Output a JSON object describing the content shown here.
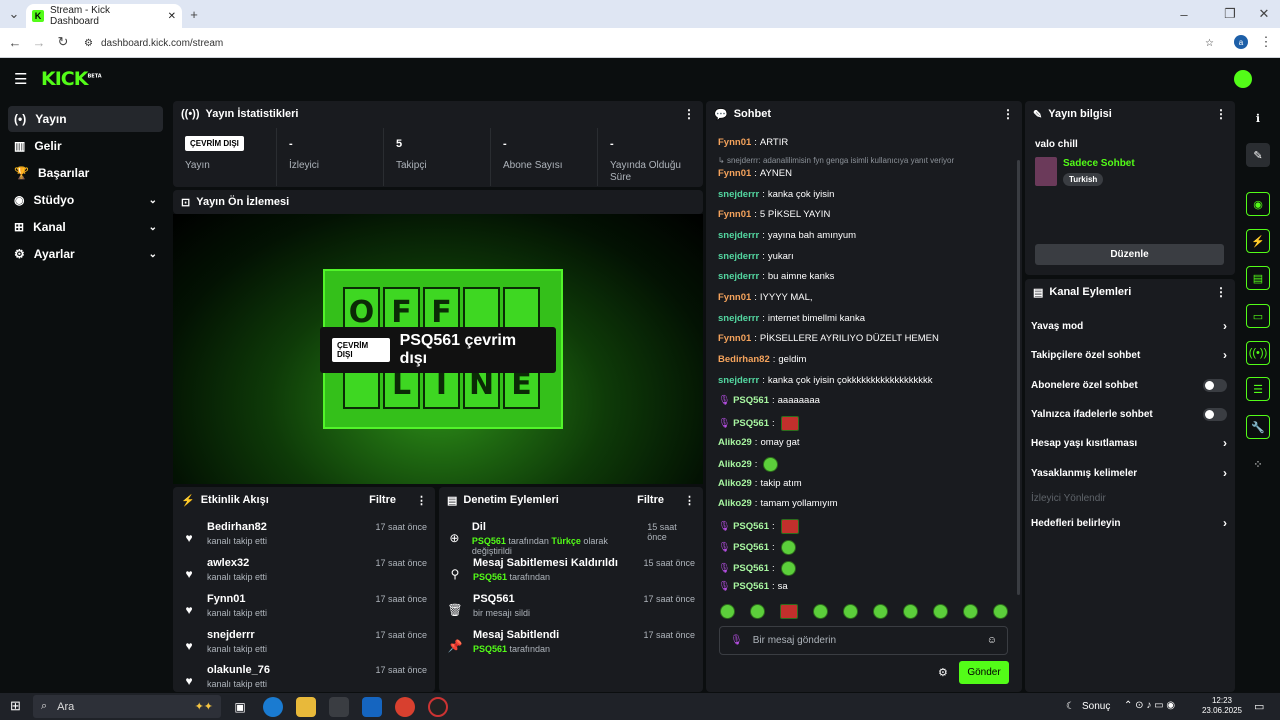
{
  "browser": {
    "tab_title": "Stream - Kick Dashboard",
    "url": "dashboard.kick.com/stream",
    "profile_initial": "a"
  },
  "app": {
    "logo": "KICK",
    "logo_sup": "BETA",
    "accent": "#53fc18"
  },
  "sidebar": {
    "items": [
      {
        "label": "Yayın",
        "icon": "broadcast-icon"
      },
      {
        "label": "Gelir",
        "icon": "chart-icon"
      },
      {
        "label": "Başarılar",
        "icon": "trophy-icon"
      },
      {
        "label": "Stüdyo",
        "icon": "studio-icon"
      },
      {
        "label": "Kanal",
        "icon": "channel-icon"
      },
      {
        "label": "Ayarlar",
        "icon": "gear-icon"
      }
    ]
  },
  "stats": {
    "title": "Yayın İstatistikleri",
    "status_badge": "ÇEVRİM DIŞI",
    "items": [
      {
        "value": "",
        "label": "Yayın"
      },
      {
        "value": "-",
        "label": "İzleyici"
      },
      {
        "value": "5",
        "label": "Takipçi"
      },
      {
        "value": "-",
        "label": "Abone Sayısı"
      },
      {
        "value": "-",
        "label": "Yayında Olduğu Süre"
      }
    ]
  },
  "preview": {
    "title": "Yayın Ön İzlemesi",
    "sign_top": [
      "O",
      "F",
      "F",
      ""
    ],
    "sign_bottom": [
      "",
      "L",
      "I",
      "N",
      "E"
    ],
    "badge": "ÇEVRİM DIŞI",
    "offline_text": "PSQ561 çevrim dışı"
  },
  "activity": {
    "title": "Etkinlik Akışı",
    "filter": "Filtre",
    "rows": [
      {
        "name": "Bedirhan82",
        "sub": "kanalı takip etti",
        "time": "17 saat önce"
      },
      {
        "name": "awlex32",
        "sub": "kanalı takip etti",
        "time": "17 saat önce"
      },
      {
        "name": "Fynn01",
        "sub": "kanalı takip etti",
        "time": "17 saat önce"
      },
      {
        "name": "snejderrr",
        "sub": "kanalı takip etti",
        "time": "17 saat önce"
      },
      {
        "name": "olakunle_76",
        "sub": "kanalı takip etti",
        "time": "17 saat önce"
      }
    ]
  },
  "moderation": {
    "title": "Denetim Eylemleri",
    "filter": "Filtre",
    "rows": [
      {
        "name": "Dil",
        "actor": "PSQ561",
        "mid": " tarafından ",
        "hl": "Türkçe",
        "end": " olarak değiştirildi",
        "time": "15 saat önce",
        "icon": "globe-icon"
      },
      {
        "name": "Mesaj Sabitlemesi Kaldırıldı",
        "actor": "PSQ561",
        "mid": " tarafından",
        "hl": "",
        "end": "",
        "time": "15 saat önce",
        "icon": "unpin-icon"
      },
      {
        "name": "PSQ561",
        "actor": "",
        "mid": "bir mesajı sildi",
        "hl": "",
        "end": "",
        "time": "17 saat önce",
        "icon": "trash-icon"
      },
      {
        "name": "Mesaj Sabitlendi",
        "actor": "PSQ561",
        "mid": " tarafından",
        "hl": "",
        "end": "",
        "time": "17 saat önce",
        "icon": "pin-icon"
      }
    ]
  },
  "chat": {
    "title": "Sohbet",
    "reply_hint": "snejderrr: adanalilimisin fyn genga isimli kullanıcıya yanıt veriyor",
    "messages": [
      {
        "user": "Fynn01",
        "color": "#f5a35c",
        "text": "ARTIR"
      },
      {
        "user": "Fynn01",
        "color": "#f5a35c",
        "text": "AYNEN"
      },
      {
        "user": "snejderrr",
        "color": "#53d6a0",
        "text": "kanka çok iyisin"
      },
      {
        "user": "Fynn01",
        "color": "#f5a35c",
        "text": "5 PİKSEL YAYIN"
      },
      {
        "user": "snejderrr",
        "color": "#53d6a0",
        "text": "yayına bah amınyum"
      },
      {
        "user": "snejderrr",
        "color": "#53d6a0",
        "text": "yukarı"
      },
      {
        "user": "snejderrr",
        "color": "#53d6a0",
        "text": "bu aimne kanks"
      },
      {
        "user": "Fynn01",
        "color": "#f5a35c",
        "text": "IYYYY MAL,"
      },
      {
        "user": "snejderrr",
        "color": "#53d6a0",
        "text": "internet bimellmi kanka"
      },
      {
        "user": "Fynn01",
        "color": "#f5a35c",
        "text": "PİKSELLERE AYRILIYO DÜZELT HEMEN"
      },
      {
        "user": "Bedirhan82",
        "color": "#f5a35c",
        "text": "geldim"
      },
      {
        "user": "snejderrr",
        "color": "#53d6a0",
        "text": "kanka çok iyisin çokkkkkkkkkkkkkkkkkk"
      },
      {
        "user": "PSQ561",
        "color": "#a7f5a0",
        "text": "aaaaaaaa",
        "mic": true
      },
      {
        "user": "PSQ561",
        "color": "#a7f5a0",
        "text": "",
        "mic": true,
        "emoji": "r"
      },
      {
        "user": "Aliko29",
        "color": "#a7f5a0",
        "text": "omay gat"
      },
      {
        "user": "Aliko29",
        "color": "#a7f5a0",
        "text": "",
        "emoji": "g"
      },
      {
        "user": "Aliko29",
        "color": "#a7f5a0",
        "text": "takip atım"
      },
      {
        "user": "Aliko29",
        "color": "#a7f5a0",
        "text": "tamam yollamıyım"
      },
      {
        "user": "PSQ561",
        "color": "#a7f5a0",
        "text": "",
        "mic": true,
        "emoji": "r"
      },
      {
        "user": "PSQ561",
        "color": "#a7f5a0",
        "text": "",
        "mic": true,
        "emoji": "g"
      },
      {
        "user": "PSQ561",
        "color": "#a7f5a0",
        "text": "",
        "mic": true,
        "emoji": "g"
      },
      {
        "user": "PSQ561",
        "color": "#a7f5a0",
        "text": "sa",
        "mic": true
      }
    ],
    "placeholder": "Bir mesaj gönderin",
    "send": "Gönder"
  },
  "stream_info": {
    "title": "Yayın bilgisi",
    "stream_title": "valo chill",
    "category": "Sadece Sohbet",
    "language": "Turkish",
    "edit": "Düzenle"
  },
  "channel_actions": {
    "title": "Kanal Eylemleri",
    "items": [
      {
        "label": "Yavaş mod",
        "control": "chevron"
      },
      {
        "label": "Takipçilere özel sohbet",
        "control": "chevron"
      },
      {
        "label": "Abonelere özel sohbet",
        "control": "toggle"
      },
      {
        "label": "Yalnızca ifadelerle sohbet",
        "control": "toggle"
      },
      {
        "label": "Hesap yaşı kısıtlaması",
        "control": "chevron"
      },
      {
        "label": "Yasaklanmış kelimeler",
        "control": "chevron"
      },
      {
        "label": "İzleyici Yönlendir",
        "control": "disabled"
      },
      {
        "label": "Hedefleri belirleyin",
        "control": "chevron"
      }
    ]
  },
  "taskbar": {
    "search": "Ara",
    "weather": "Sonuç",
    "time": "12:23",
    "date": "23.06.2025"
  }
}
